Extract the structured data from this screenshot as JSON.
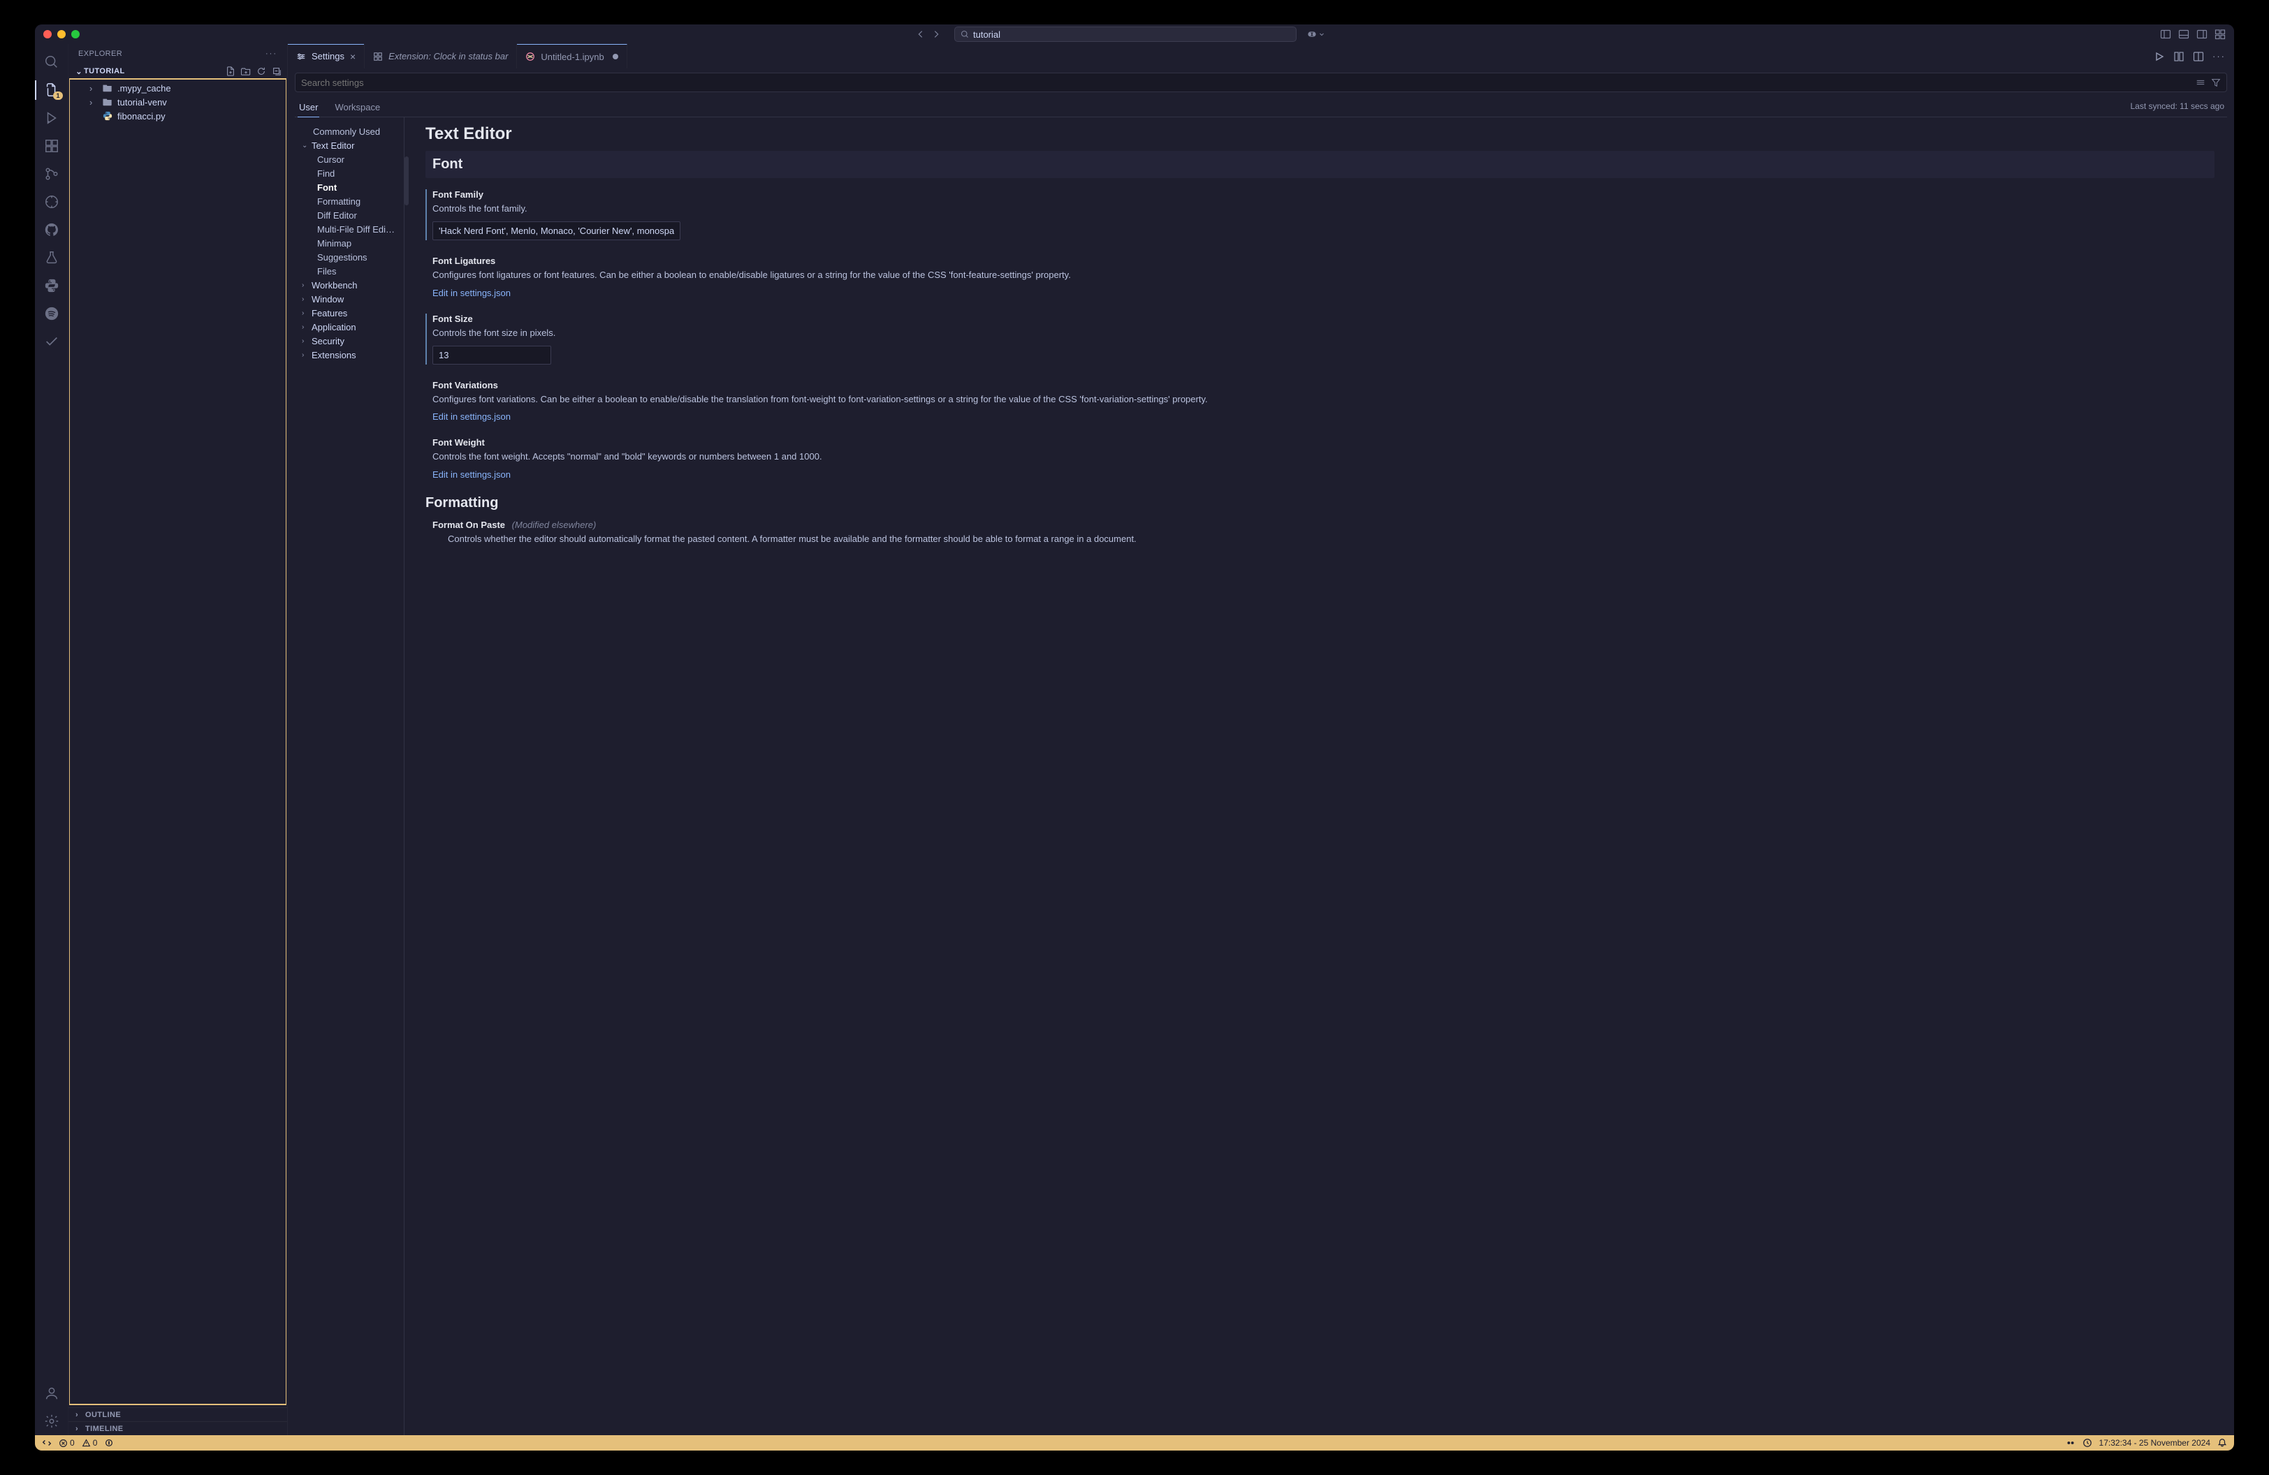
{
  "titlebar": {
    "search_text": "tutorial"
  },
  "sidebar": {
    "title": "EXPLORER",
    "project": "TUTORIAL",
    "tree": {
      "mypy": ".mypy_cache",
      "venv": "tutorial-venv",
      "fib": "fibonacci.py"
    },
    "outline": "OUTLINE",
    "timeline": "TIMELINE"
  },
  "tabs": {
    "settings": "Settings",
    "extension": "Extension: Clock in status bar",
    "notebook": "Untitled-1.ipynb"
  },
  "settings": {
    "search_placeholder": "Search settings",
    "scope_user": "User",
    "scope_workspace": "Workspace",
    "synced": "Last synced: 11 secs ago",
    "toc": {
      "commonly": "Commonly Used",
      "texteditor": "Text Editor",
      "cursor": "Cursor",
      "find": "Find",
      "font": "Font",
      "formatting": "Formatting",
      "diff": "Diff Editor",
      "multidiff": "Multi-File Diff Edi…",
      "minimap": "Minimap",
      "suggestions": "Suggestions",
      "files": "Files",
      "workbench": "Workbench",
      "window": "Window",
      "features": "Features",
      "application": "Application",
      "security": "Security",
      "extensions": "Extensions"
    },
    "content": {
      "h1": "Text Editor",
      "h2": "Font",
      "font_family": {
        "label": "Font Family",
        "desc": "Controls the font family.",
        "value": "'Hack Nerd Font', Menlo, Monaco, 'Courier New', monospace"
      },
      "font_ligatures": {
        "label": "Font Ligatures",
        "desc": "Configures font ligatures or font features. Can be either a boolean to enable/disable ligatures or a string for the value of the CSS 'font-feature-settings' property.",
        "link": "Edit in settings.json"
      },
      "font_size": {
        "label": "Font Size",
        "desc": "Controls the font size in pixels.",
        "value": "13"
      },
      "font_variations": {
        "label": "Font Variations",
        "desc": "Configures font variations. Can be either a boolean to enable/disable the translation from font-weight to font-variation-settings or a string for the value of the CSS 'font-variation-settings' property.",
        "link": "Edit in settings.json"
      },
      "font_weight": {
        "label": "Font Weight",
        "desc": "Controls the font weight. Accepts \"normal\" and \"bold\" keywords or numbers between 1 and 1000.",
        "link": "Edit in settings.json"
      },
      "h3": "Formatting",
      "format_on_paste": {
        "label": "Format On Paste",
        "mod": "(Modified elsewhere)",
        "desc": "Controls whether the editor should automatically format the pasted content. A formatter must be available and the formatter should be able to format a range in a document."
      }
    }
  },
  "statusbar": {
    "errors": "0",
    "warnings": "0",
    "clock": "17:32:34 - 25 November 2024"
  },
  "activity_badge": "1"
}
